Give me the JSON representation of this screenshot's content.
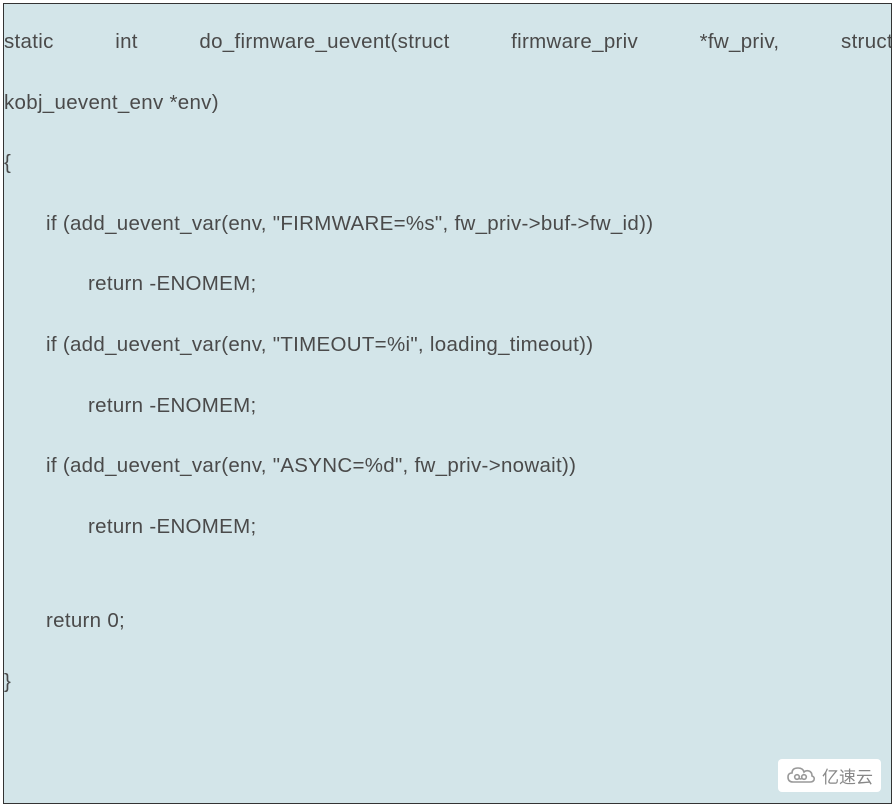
{
  "code": {
    "line1_a": "static",
    "line1_b": "int",
    "line1_c": "do_firmware_uevent(struct",
    "line1_d": "firmware_priv",
    "line1_e": "*fw_priv,",
    "line1_f": "struct",
    "line2": "kobj_uevent_env *env)",
    "line3": "{",
    "line4": "if (add_uevent_var(env, \"FIRMWARE=%s\", fw_priv->buf->fw_id))",
    "line5": "return -ENOMEM;",
    "line6": "if (add_uevent_var(env, \"TIMEOUT=%i\", loading_timeout))",
    "line7": "return -ENOMEM;",
    "line8": "if (add_uevent_var(env, \"ASYNC=%d\", fw_priv->nowait))",
    "line9": "return -ENOMEM;",
    "line10": "return 0;",
    "line11": "}"
  },
  "watermark": {
    "text": "亿速云"
  }
}
